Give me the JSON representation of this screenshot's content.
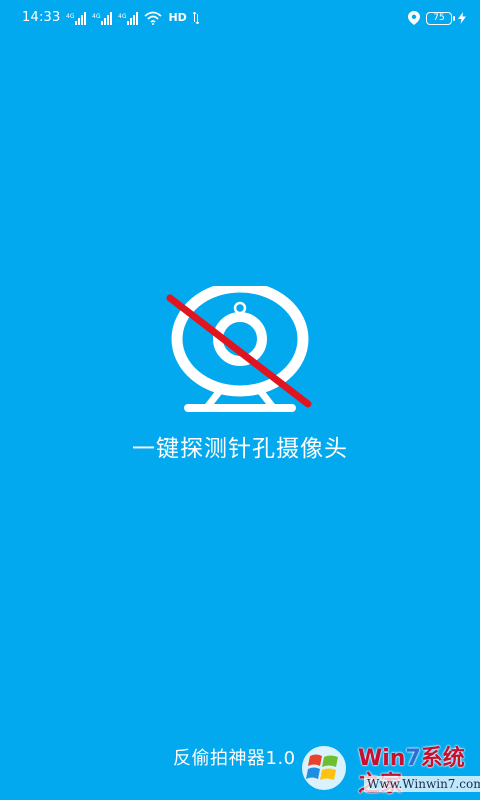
{
  "status_bar": {
    "time": "14:33",
    "network": "HD",
    "battery_level": "75"
  },
  "splash": {
    "tagline": "一键探测针孔摄像头",
    "app_version": "反偷拍神器1.0"
  },
  "watermark": {
    "title_prefix": "Win",
    "title_digit": "7",
    "title_suffix": "系统之家",
    "url": "Www.Winwin7.com"
  },
  "colors": {
    "background": "#03A9EE",
    "foreground": "#FFFFFF",
    "slash": "#E0151F"
  }
}
